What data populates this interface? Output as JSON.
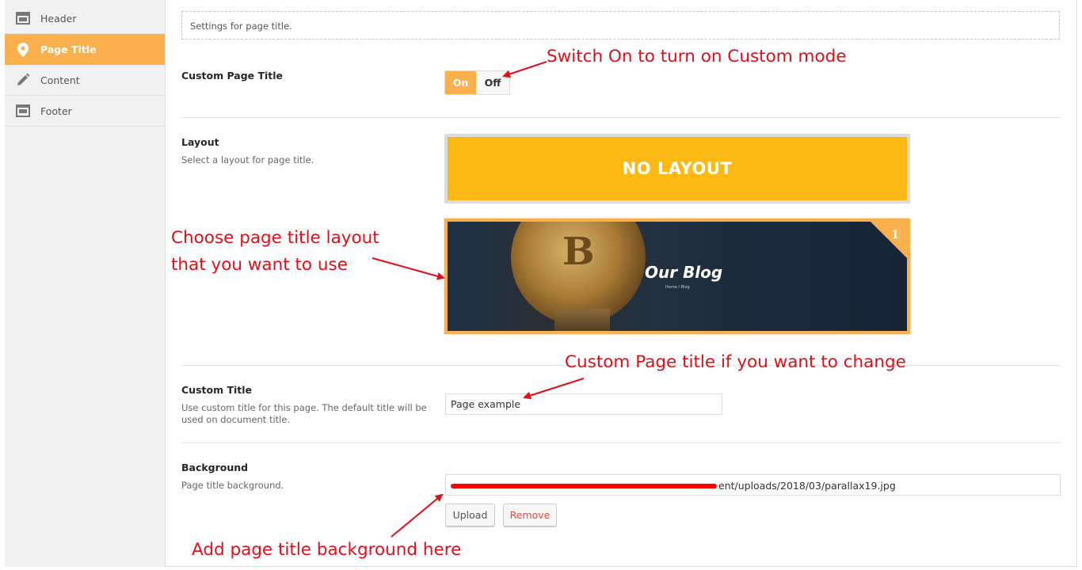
{
  "sidebar": {
    "items": [
      {
        "label": "Header",
        "icon": "layout-header-icon"
      },
      {
        "label": "Page Title",
        "icon": "map-pin-icon",
        "active": true
      },
      {
        "label": "Content",
        "icon": "pencil-icon"
      },
      {
        "label": "Footer",
        "icon": "layout-footer-icon"
      }
    ],
    "accent_color": "#fbb04e"
  },
  "section": {
    "description": "Settings for page title."
  },
  "custom_page_title": {
    "label": "Custom Page Title",
    "on_label": "On",
    "off_label": "Off"
  },
  "layout": {
    "label": "Layout",
    "description": "Select a layout for page title.",
    "options": [
      {
        "label": "NO LAYOUT",
        "color": "#fdb913"
      },
      {
        "title": "Our Blog",
        "breadcrumb": "Home  /  Blog",
        "number": "1",
        "selected": true
      }
    ]
  },
  "custom_title": {
    "label": "Custom Title",
    "description": "Use custom title for this page. The default title will be used on document title.",
    "value": "Page example"
  },
  "background": {
    "label": "Background",
    "description": "Page title background.",
    "value_visible": "ent/uploads/2018/03/parallax19.jpg",
    "upload_label": "Upload",
    "remove_label": "Remove"
  },
  "annotations": {
    "switch": "Switch On to turn on Custom mode",
    "layout_line1": "Choose page title layout",
    "layout_line2": "that you want to use",
    "custom_title": "Custom Page title if you want to change",
    "background": "Add page title background here",
    "color": "#e0101a"
  }
}
